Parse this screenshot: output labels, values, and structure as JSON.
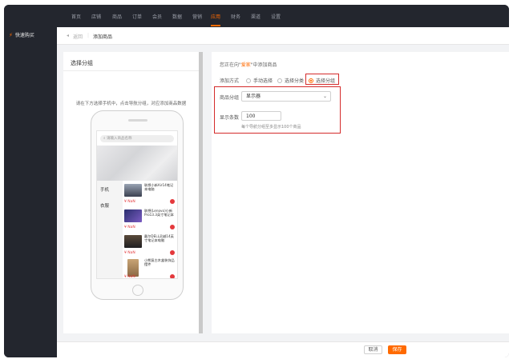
{
  "sidebar": {
    "item_label": "快速购买"
  },
  "topnav": {
    "items": [
      {
        "label": "首页"
      },
      {
        "label": "店铺"
      },
      {
        "label": "商品"
      },
      {
        "label": "订单"
      },
      {
        "label": "会员"
      },
      {
        "label": "数据"
      },
      {
        "label": "营销"
      },
      {
        "label": "应用"
      },
      {
        "label": "财务"
      },
      {
        "label": "渠道"
      },
      {
        "label": "设置"
      }
    ],
    "active": "应用"
  },
  "breadcrumb": {
    "back": "返回",
    "current": "添加商品"
  },
  "left_panel": {
    "title": "选择分组",
    "hint": "请在下方选择手机中，点击导航分组，对应添加商品数据",
    "phone": {
      "search_placeholder": "请输入商品名称",
      "categories": [
        {
          "label": "手机"
        },
        {
          "label": "衣服"
        }
      ],
      "products": [
        {
          "name": "联想小新Air14笔记本电脑",
          "price": "¥ NaN"
        },
        {
          "name": "联想(Lenovo)小新Pro13.3英寸笔记本",
          "price": "¥ NaN"
        },
        {
          "name": "戴尔DELL灵越14英寸笔记本电脑",
          "price": "¥ NaN"
        },
        {
          "name": "小熊复古木盒装饰品摆件",
          "price": "¥ NaN"
        }
      ]
    }
  },
  "right_panel": {
    "add_to_prefix": "您正在向\"",
    "add_to_target": "爱家",
    "add_to_suffix": "\"中添加商品",
    "add_method_label": "添加方式",
    "options": [
      {
        "label": "手动选择",
        "selected": false
      },
      {
        "label": "选择分类",
        "selected": false
      },
      {
        "label": "选择分组",
        "selected": true
      }
    ],
    "group_label": "商品分组",
    "group_value": "显示器",
    "count_label": "显示条数",
    "count_value": "100",
    "count_hint": "每个导航分组至多显示100个商品"
  },
  "footer": {
    "cancel": "取消",
    "save": "保存"
  },
  "colors": {
    "accent": "#ff6a00",
    "dark": "#23262e",
    "highlight_box": "#d42b2b"
  }
}
